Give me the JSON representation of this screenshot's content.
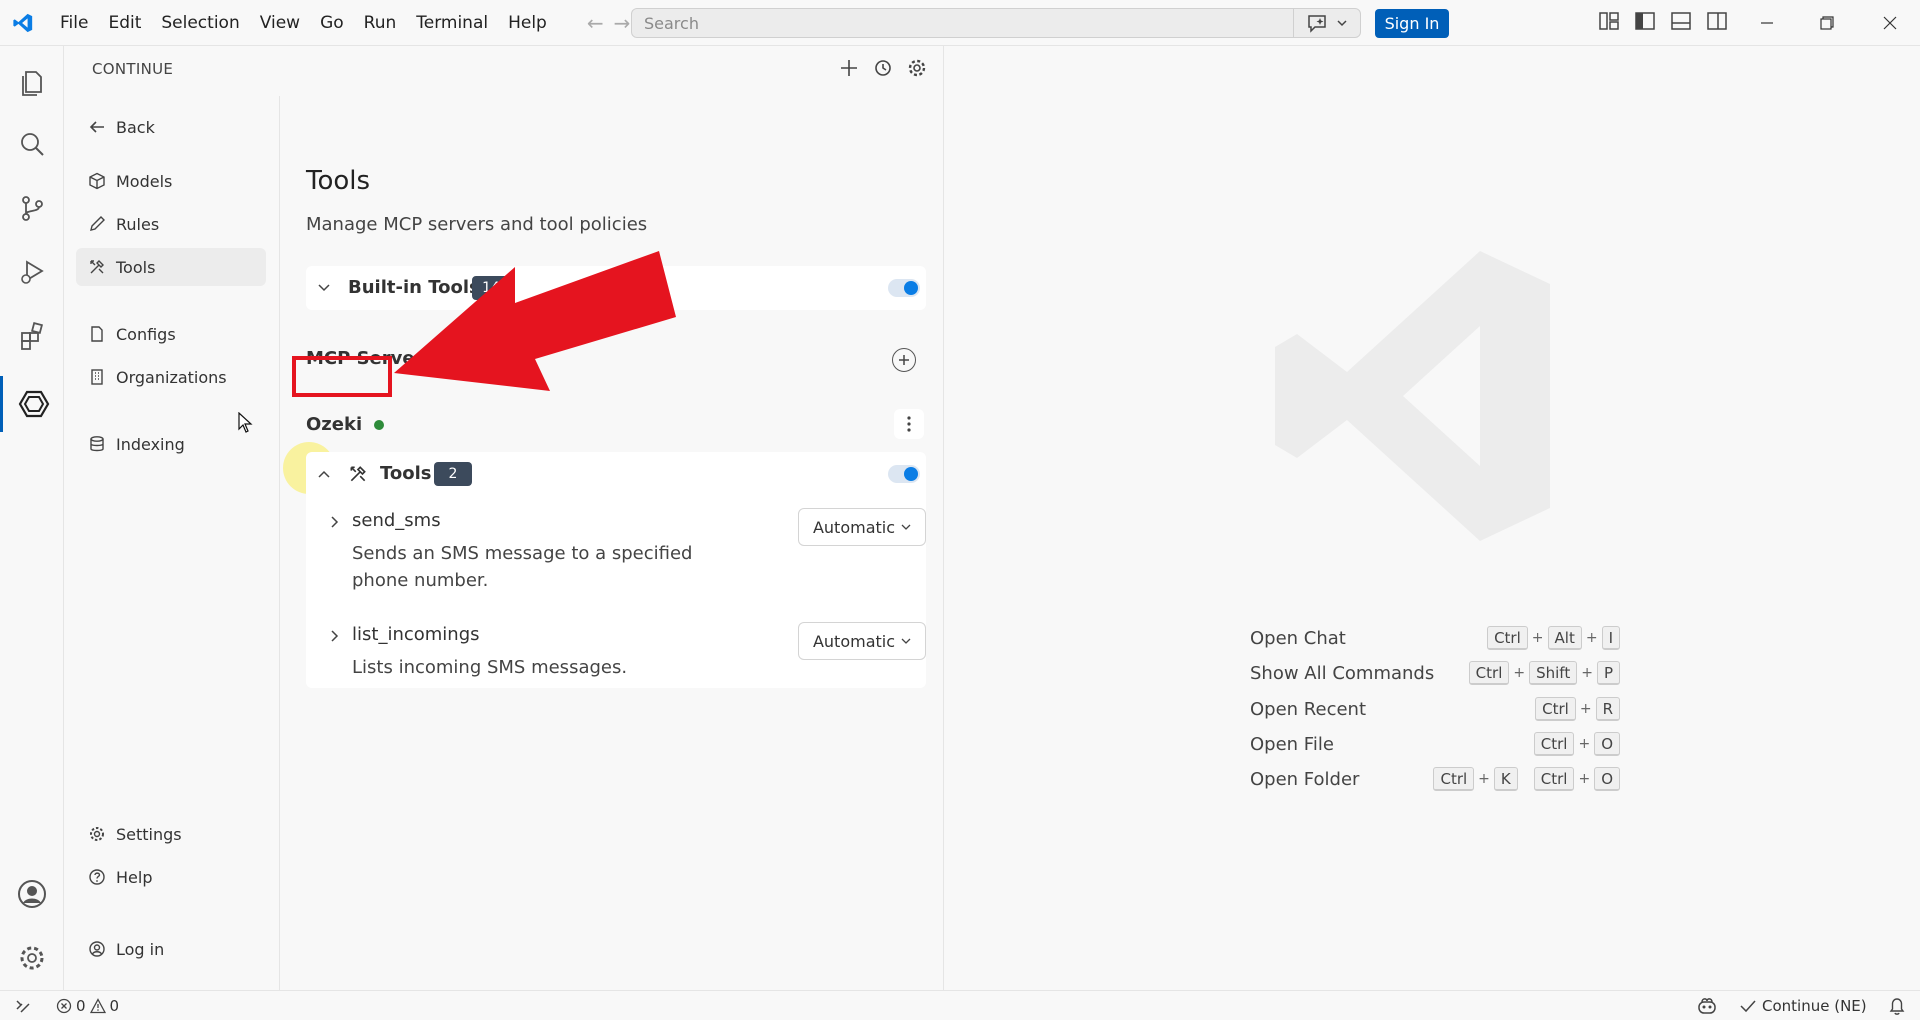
{
  "titlebar": {
    "menus": [
      "File",
      "Edit",
      "Selection",
      "View",
      "Go",
      "Run",
      "Terminal",
      "Help"
    ],
    "search_placeholder": "Search",
    "sign_in": "Sign In"
  },
  "panel": {
    "title": "CONTINUE"
  },
  "leftnav": {
    "back": "Back",
    "items": [
      "Models",
      "Rules",
      "Tools",
      "Configs",
      "Organizations",
      "Indexing",
      "Settings",
      "Help",
      "Log in"
    ]
  },
  "tools_page": {
    "title": "Tools",
    "subtitle": "Manage MCP servers and tool policies",
    "builtin_label": "Built-in Tools",
    "builtin_count": "14",
    "mcp_label": "MCP Servers",
    "server_name": "Ozeki",
    "server_tools_label": "Tools",
    "server_tools_count": "2",
    "tools": [
      {
        "name": "send_sms",
        "desc": "Sends an SMS message to a specified phone number.",
        "policy": "Automatic"
      },
      {
        "name": "list_incomings",
        "desc": "Lists incoming SMS messages.",
        "policy": "Automatic"
      }
    ]
  },
  "editor": {
    "shortcuts": [
      {
        "label": "Open Chat",
        "keys": [
          [
            "Ctrl",
            "Alt",
            "I"
          ]
        ]
      },
      {
        "label": "Show All Commands",
        "keys": [
          [
            "Ctrl",
            "Shift",
            "P"
          ]
        ]
      },
      {
        "label": "Open Recent",
        "keys": [
          [
            "Ctrl",
            "R"
          ]
        ]
      },
      {
        "label": "Open File",
        "keys": [
          [
            "Ctrl",
            "O"
          ]
        ]
      },
      {
        "label": "Open Folder",
        "keys": [
          [
            "Ctrl",
            "K"
          ],
          [
            "Ctrl",
            "O"
          ]
        ]
      }
    ]
  },
  "statusbar": {
    "errors": "0",
    "warnings": "0",
    "continue_status": "Continue (NE)"
  },
  "colors": {
    "accent": "#005fb8",
    "status_dot": "#2e8b3a",
    "highlight": "#e5141f"
  }
}
